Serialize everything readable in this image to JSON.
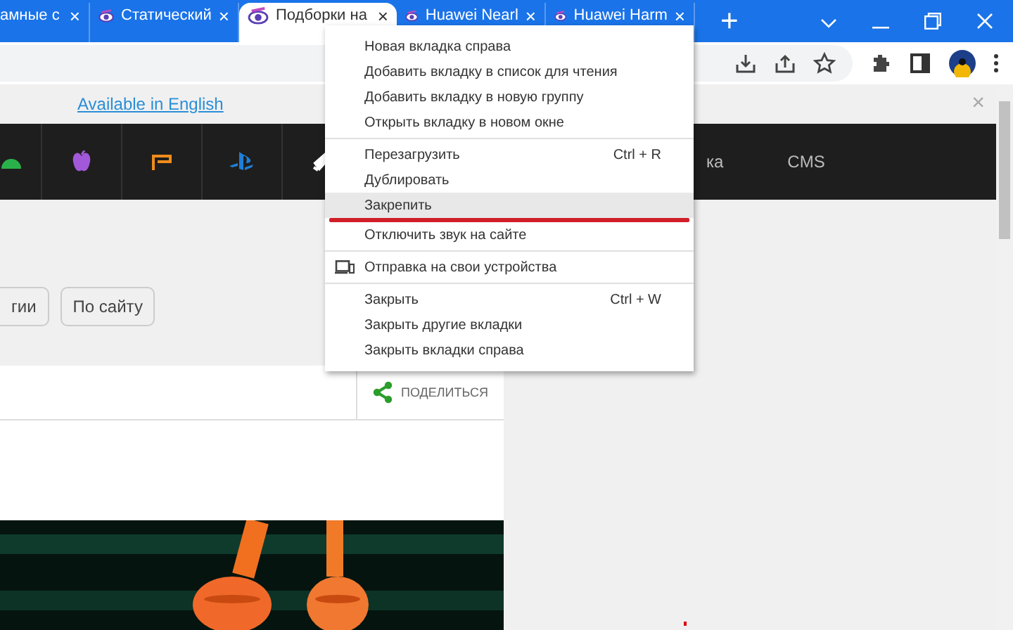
{
  "tabs": [
    {
      "title": "амные с",
      "selected": false,
      "close": "×"
    },
    {
      "title": "Статический",
      "selected": false,
      "close": "×"
    },
    {
      "title": "Подборки на",
      "selected": true,
      "close": "×"
    },
    {
      "title": "Huawei Nearl",
      "selected": false,
      "close": "×"
    },
    {
      "title": "Huawei Harm",
      "selected": false,
      "close": "×"
    }
  ],
  "new_tab": "+",
  "info_bar": {
    "link": "Available in English",
    "close": "×"
  },
  "nav_bar": {
    "items": [
      "ка",
      "CMS"
    ]
  },
  "filter_buttons": [
    "гии",
    "По сайту"
  ],
  "share": {
    "label": "ПОДЕЛИТЬСЯ"
  },
  "context_menu": {
    "sections": [
      [
        {
          "label": "Новая вкладка справа",
          "selected": false
        },
        {
          "label": "Добавить вкладку в список для чтения",
          "selected": false
        },
        {
          "label": "Добавить вкладку в новую группу",
          "selected": false
        },
        {
          "label": "Открыть вкладку в новом окне",
          "selected": false
        }
      ],
      [
        {
          "label": "Перезагрузить",
          "shortcut": "Ctrl + R",
          "selected": false
        },
        {
          "label": "Дублировать",
          "selected": false
        },
        {
          "label": "Закрепить",
          "selected": true
        },
        {
          "label": "Отключить звук на сайте",
          "selected": false
        }
      ],
      [
        {
          "label": "Отправка на свои устройства",
          "selected": false,
          "kind": "device"
        }
      ],
      [
        {
          "label": "Закрыть",
          "shortcut": "Ctrl + W",
          "selected": false
        },
        {
          "label": "Закрыть другие вкладки",
          "selected": false
        },
        {
          "label": "Закрыть вкладки справа",
          "selected": false
        }
      ]
    ]
  }
}
